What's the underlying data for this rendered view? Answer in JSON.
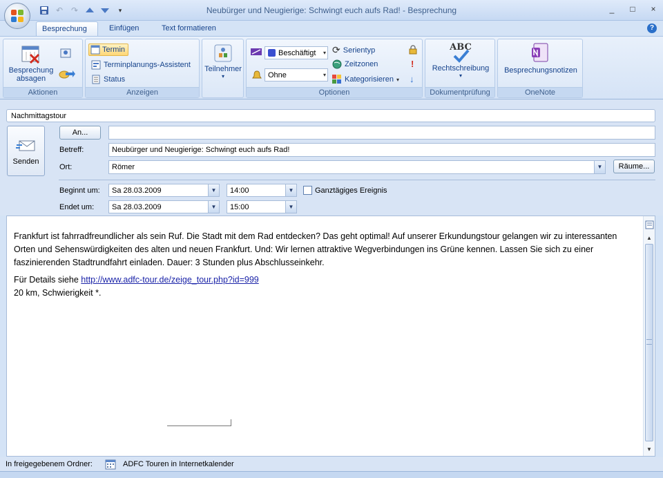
{
  "window": {
    "title": "Neubürger und Neugierige: Schwingt euch aufs Rad! - Besprechung",
    "minimize": "_",
    "maximize": "□",
    "close": "×"
  },
  "tabs": [
    {
      "label": "Besprechung",
      "active": true
    },
    {
      "label": "Einfügen",
      "active": false
    },
    {
      "label": "Text formatieren",
      "active": false
    }
  ],
  "help_label": "?",
  "ribbon": {
    "aktionen": {
      "label": "Aktionen",
      "cancel_line1": "Besprechung",
      "cancel_line2": "absagen"
    },
    "anzeigen": {
      "label": "Anzeigen",
      "termin": "Termin",
      "assistent": "Terminplanungs-Assistent",
      "status": "Status"
    },
    "teilnehmer": {
      "label": "Teilnehmer"
    },
    "optionen": {
      "label": "Optionen",
      "busy": "Beschäftigt",
      "reminder": "Ohne",
      "serientyp": "Serientyp",
      "zeitzonen": "Zeitzonen",
      "kategorisieren": "Kategorisieren"
    },
    "dokumentpruefung": {
      "label": "Dokumentprüfung",
      "spelling": "Rechtschreibung",
      "abc": "ABC"
    },
    "onenote": {
      "label": "OneNote",
      "notes": "Besprechungsnotizen"
    }
  },
  "form": {
    "info_bar": "Nachmittagstour",
    "send": "Senden",
    "to_button": "An...",
    "to_value": "",
    "subject_label": "Betreff:",
    "subject_value": "Neubürger und Neugierige: Schwingt euch aufs Rad!",
    "location_label": "Ort:",
    "location_value": "Römer",
    "rooms_button": "Räume...",
    "start_label": "Beginnt um:",
    "start_date": "Sa 28.03.2009",
    "start_time": "14:00",
    "allday_label": "Ganztägiges Ereignis",
    "allday_checked": false,
    "end_label": "Endet um:",
    "end_date": "Sa 28.03.2009",
    "end_time": "15:00"
  },
  "body": {
    "paragraph1": "Frankfurt ist fahrradfreundlicher als sein Ruf. Die Stadt mit dem Rad entdecken? Das geht optimal! Auf unserer Erkundungstour gelangen wir zu interessanten Orten und Sehenswürdigkeiten des alten und neuen Frankfurt. Und: Wir lernen attraktive Wegverbindungen ins Grüne kennen. Lassen Sie sich zu einer faszinierenden Stadtrundfahrt einladen. Dauer: 3 Stunden plus Abschlusseinkehr.",
    "details_prefix": "Für Details siehe ",
    "details_link": "http://www.adfc-tour.de/zeige_tour.php?id=999",
    "line3": "20 km, Schwierigkeit *."
  },
  "status": {
    "shared_label": "In freigegebenem Ordner:",
    "folder_name": "ADFC Touren in Internetkalender"
  }
}
